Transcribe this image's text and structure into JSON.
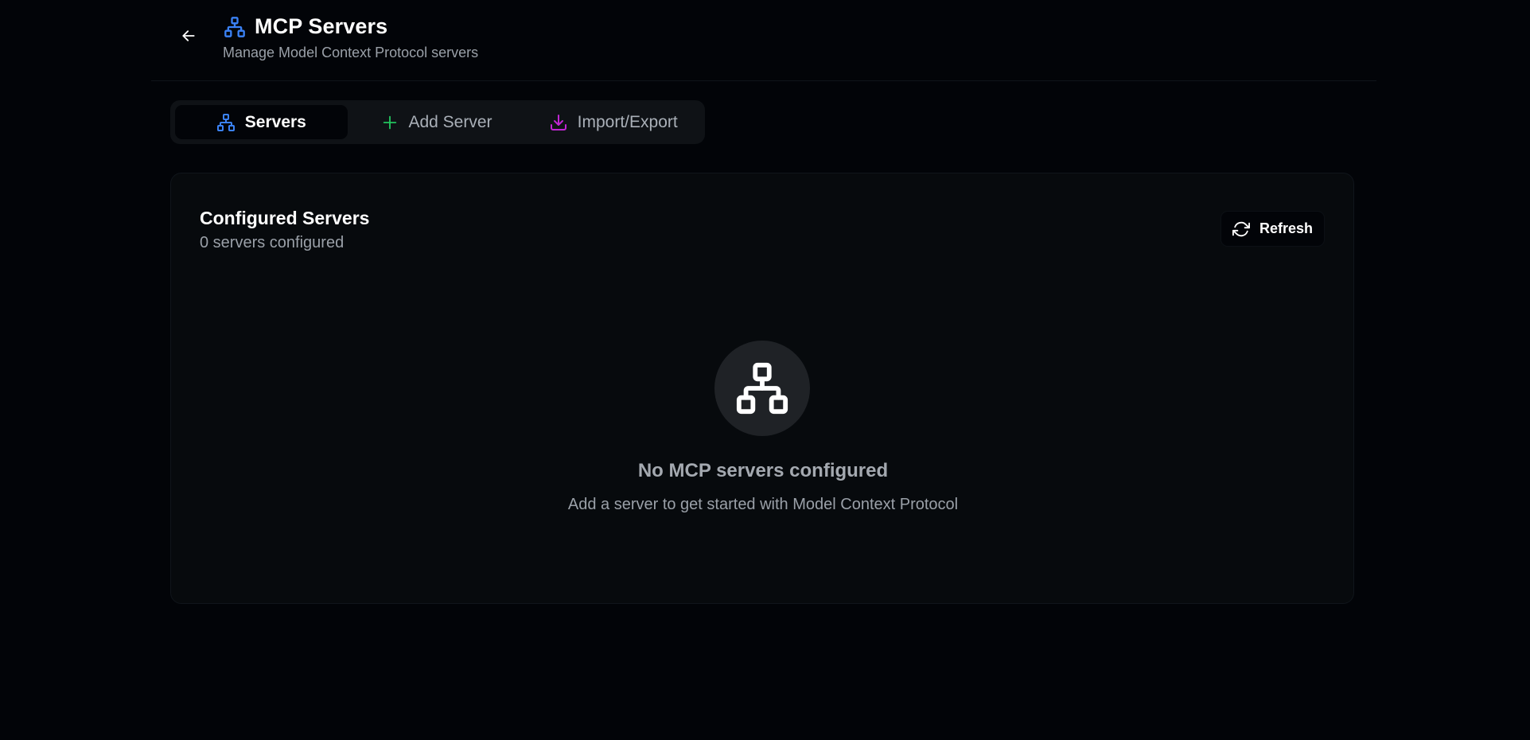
{
  "header": {
    "title": "MCP Servers",
    "subtitle": "Manage Model Context Protocol servers",
    "back_icon": "arrow-left-icon",
    "title_icon": "network-icon"
  },
  "tabs": [
    {
      "label": "Servers",
      "icon": "network-icon",
      "icon_color": "#3b82f6",
      "active": true
    },
    {
      "label": "Add Server",
      "icon": "plus-icon",
      "icon_color": "#22c55e",
      "active": false
    },
    {
      "label": "Import/Export",
      "icon": "download-icon",
      "icon_color": "#c026d3",
      "active": false
    }
  ],
  "card": {
    "title": "Configured Servers",
    "subtitle": "0 servers configured",
    "refresh_label": "Refresh",
    "refresh_icon": "refresh-icon"
  },
  "empty_state": {
    "icon": "network-icon",
    "title": "No MCP servers configured",
    "text": "Add a server to get started with Model Context Protocol"
  },
  "colors": {
    "background": "#020408",
    "card": "#070a0d",
    "accent_blue": "#3b82f6",
    "accent_green": "#22c55e",
    "accent_purple": "#c026d3"
  }
}
